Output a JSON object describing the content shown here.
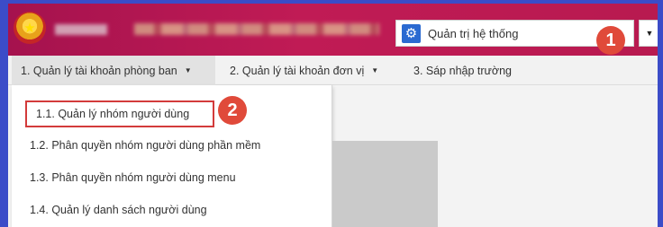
{
  "header": {
    "emblem_glyph": "★",
    "system_select": {
      "icon": "gear-icon",
      "icon_glyph": "⚙",
      "value": "Quản trị hệ thống",
      "arrow_glyph": "▼"
    },
    "badge_1": "1"
  },
  "menubar": {
    "items": [
      {
        "label": "1. Quản lý tài khoản phòng ban",
        "caret": "▼"
      },
      {
        "label": "2. Quản lý tài khoản đơn vị",
        "caret": "▼"
      },
      {
        "label": "3. Sáp nhập trường"
      }
    ]
  },
  "dropdown": {
    "items": [
      {
        "label": "1.1. Quản lý nhóm người dùng"
      },
      {
        "label": "1.2. Phân quyền nhóm người dùng phần mềm"
      },
      {
        "label": "1.3. Phân quyền nhóm người dùng menu"
      },
      {
        "label": "1.4. Quản lý danh sách người dùng"
      }
    ],
    "badge_2": "2"
  },
  "colors": {
    "frame": "#3b4cc8",
    "header": "#b81a50",
    "highlight": "#d33b3b",
    "badge": "#e04a3a"
  }
}
